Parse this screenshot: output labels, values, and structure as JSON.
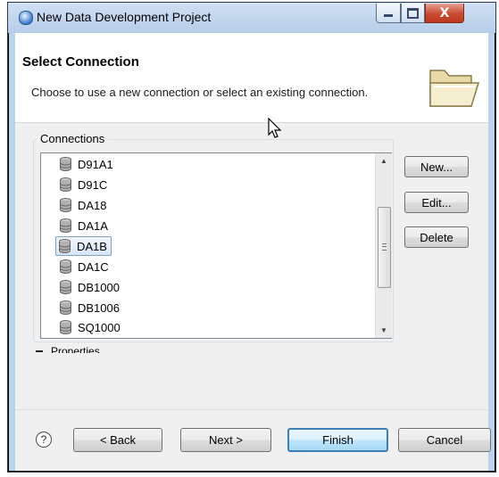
{
  "window": {
    "title": "New Data Development Project",
    "controls": {
      "minimize_icon": "minimize-icon",
      "maximize_icon": "maximize-icon",
      "close_icon": "close-icon",
      "close_glyph": "X"
    }
  },
  "header": {
    "title": "Select Connection",
    "description": "Choose to use a new connection or select an existing connection.",
    "icon": "folder-icon"
  },
  "connections": {
    "group_label": "Connections",
    "items": [
      {
        "label": "D91A1",
        "selected": false
      },
      {
        "label": "D91C",
        "selected": false
      },
      {
        "label": "DA18",
        "selected": false
      },
      {
        "label": "DA1A",
        "selected": false
      },
      {
        "label": "DA1B",
        "selected": true
      },
      {
        "label": "DA1C",
        "selected": false
      },
      {
        "label": "DB1000",
        "selected": false
      },
      {
        "label": "DB1006",
        "selected": false
      },
      {
        "label": "SQ1000",
        "selected": false
      }
    ],
    "scroll": {
      "up_glyph": "▲",
      "down_glyph": "▼"
    },
    "buttons": {
      "new": "New...",
      "edit": "Edit...",
      "delete": "Delete"
    }
  },
  "properties": {
    "label": "Properties",
    "collapse_glyph": "—"
  },
  "footer": {
    "help_glyph": "?",
    "back": "< Back",
    "next": "Next >",
    "finish": "Finish",
    "cancel": "Cancel"
  }
}
